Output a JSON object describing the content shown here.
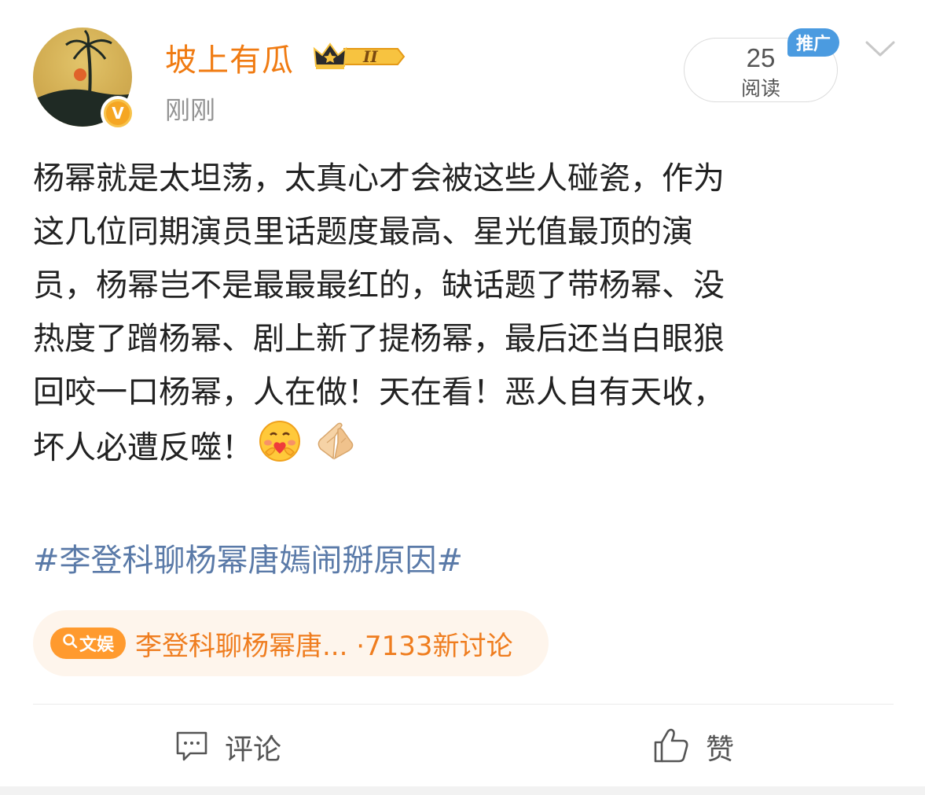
{
  "post": {
    "username": "坡上有瓜",
    "level_badge": "II",
    "timestamp": "刚刚",
    "verified_mark": "V",
    "reads_count": "25",
    "reads_label": "阅读",
    "promo_tag": "推广",
    "content_lines": [
      "杨幂就是太坦荡，太真心才会被这些人碰瓷，作为",
      "这几位同期演员里话题度最高、星光值最顶的演",
      "员，杨幂岂不是最最最红的，缺话题了带杨幂、没",
      "热度了蹭杨幂、剧上新了提杨幂，最后还当白眼狼",
      "回咬一口杨幂，人在做！天在看！恶人自有天收，",
      "坏人必遭反噬！"
    ],
    "emojis": [
      "hug-emoji",
      "praying-hands-emoji"
    ],
    "hashtag": "#李登科聊杨幂唐嫣闹掰原因#",
    "topic_card": {
      "tag_label": "文娱",
      "text": "李登科聊杨幂唐... ·7133新讨论"
    }
  },
  "actions": {
    "comment_label": "评论",
    "like_label": "赞"
  },
  "colors": {
    "username": "#f07b12",
    "hashtag": "#5a7aa8",
    "promo": "#4b9be0",
    "topic_bg": "#fef5ec",
    "topic_text": "#ef7d1f"
  }
}
